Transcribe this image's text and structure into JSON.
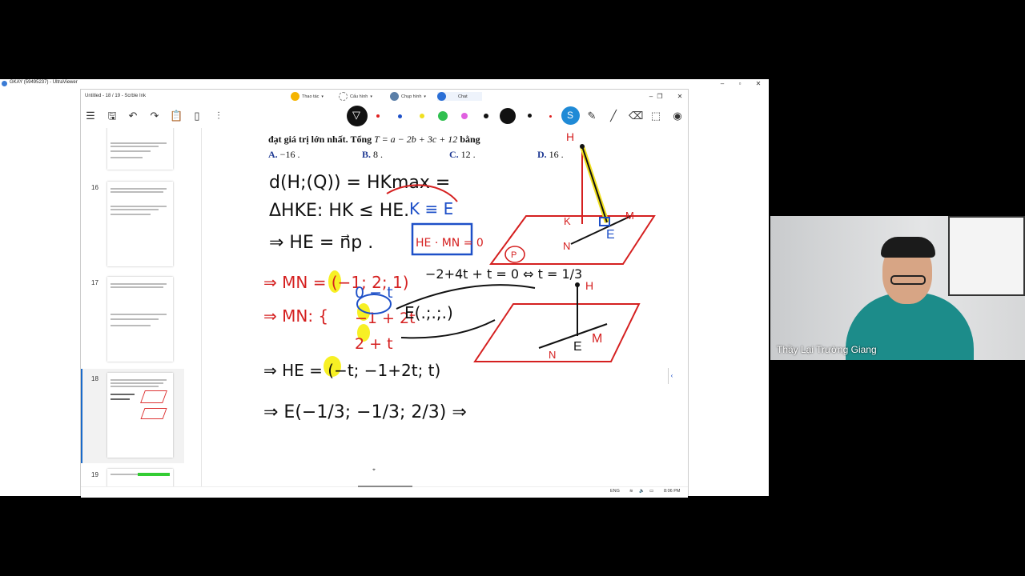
{
  "remote_window": {
    "title": "GKAY (59495237) - UltraViewer",
    "minimize": "–",
    "maximize": "▫",
    "close": "✕"
  },
  "app": {
    "title": "Untitled - 18 / 19 - Scrble Ink",
    "menus": [
      {
        "label": "Thao tác",
        "icon": "pen-badge-icon",
        "color": "#f5b400"
      },
      {
        "label": "Cấu hình",
        "icon": "gear-icon",
        "color": "#888888"
      },
      {
        "label": "Chụp hình",
        "icon": "camera-icon",
        "color": "#2b6fd6"
      },
      {
        "label": "Chat",
        "icon": "chat-icon",
        "color": "#2b6fd6"
      }
    ],
    "window_min": "–",
    "window_restore": "❐",
    "window_close": "✕"
  },
  "toolbar": {
    "pen_colors": [
      "#e02020",
      "#1e50c8",
      "#f0e020",
      "#30c050",
      "#e060e0",
      "#111111",
      "#111111",
      "#e02020"
    ],
    "active_tool_color": "#1f8ad6"
  },
  "sidebar": {
    "pages": [
      {
        "number": "16"
      },
      {
        "number": "17"
      },
      {
        "number": "18",
        "active": true
      },
      {
        "number": "19"
      }
    ]
  },
  "canvas": {
    "question_line": "đạt giá trị lớn nhất. Tổng",
    "formula": "T = a − 2b + 3c + 12",
    "question_end": "bằng",
    "options": [
      {
        "label": "A.",
        "value": "−16 ."
      },
      {
        "label": "B.",
        "value": "8 ."
      },
      {
        "label": "C.",
        "value": "12 ."
      },
      {
        "label": "D.",
        "value": "16 ."
      }
    ],
    "handwriting": {
      "line1": "d(H;(Q)) = HKmax =",
      "line2": "ΔHKE: HK ≤ HE.",
      "line3": "⇒ HE = n⃗p .",
      "line4": "⇒ MN = (−1; 2; 1)",
      "line5_x": "0 − t",
      "line5_y": "−1 + 2t",
      "line5_z": "2 + t",
      "line6": "⇒ HE = (−t; −1+2t; t)",
      "line7": "⇒ E(−1/3; −1/3; 2/3) ⇒",
      "blue_k_eq_e": "K ≡ E",
      "blue_box": "HE · MN = 0",
      "mid_eq": "−2+4t + t = 0 ⇔ t = 1/3",
      "e_param": "E(.;.;.)",
      "fig_labels": [
        "H",
        "K",
        "M",
        "N",
        "E",
        "P",
        "H",
        "N",
        "E",
        "M"
      ]
    }
  },
  "status": {
    "lang": "ENG",
    "time": "8:06 PM"
  },
  "webcam": {
    "name": "Thầy Lại Trường Giang"
  }
}
